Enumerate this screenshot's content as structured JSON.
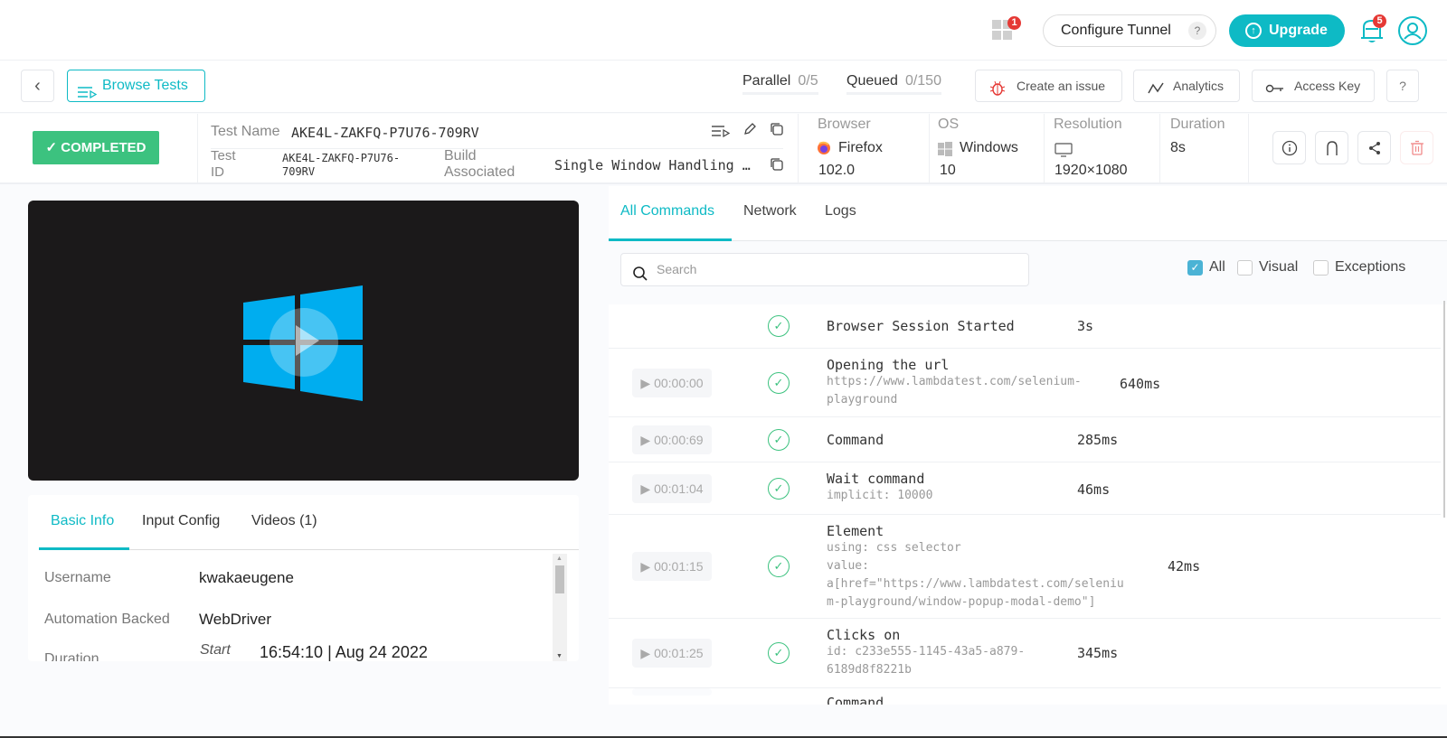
{
  "topbar": {
    "apps_badge": "1",
    "configure_tunnel": "Configure Tunnel",
    "tunnel_help": "?",
    "upgrade": "Upgrade",
    "notifications_badge": "5"
  },
  "toolbar": {
    "back": "‹",
    "browse_tests": "Browse Tests",
    "parallel_label": "Parallel",
    "parallel_value": "0/5",
    "queued_label": "Queued",
    "queued_value": "0/150",
    "create_issue": "Create an issue",
    "analytics": "Analytics",
    "access_key": "Access Key",
    "help": "?"
  },
  "test": {
    "status": "✓ COMPLETED",
    "name_label": "Test Name",
    "name": "AKE4L-ZAKFQ-P7U76-709RV",
    "id_label_1": "Test",
    "id_label_2": "ID",
    "id_line1": "AKE4L-ZAKFQ-P7U76-",
    "id_line2": "709RV",
    "build_label_1": "Build",
    "build_label_2": "Associated",
    "build": "Single Window Handling …",
    "browser_label": "Browser",
    "browser": "Firefox",
    "browser_version": "102.0",
    "os_label": "OS",
    "os": "Windows",
    "os_version": "10",
    "resolution_label": "Resolution",
    "resolution": "1920×1080",
    "duration_label": "Duration",
    "duration": "8s"
  },
  "info_tabs": [
    {
      "label": "Basic Info",
      "active": true
    },
    {
      "label": "Input Config",
      "active": false
    },
    {
      "label": "Videos (1)",
      "active": false
    }
  ],
  "basic_info": {
    "username_label": "Username",
    "username": "kwakaeugene",
    "automation_label": "Automation Backed",
    "automation": "WebDriver",
    "duration_label": "Duration",
    "start_label": "Start",
    "start_value": "16:54:10 | Aug 24 2022"
  },
  "command_tabs": [
    {
      "label": "All Commands",
      "active": true
    },
    {
      "label": "Network",
      "active": false
    },
    {
      "label": "Logs",
      "active": false
    }
  ],
  "filters": {
    "search_placeholder": "Search",
    "all": "All",
    "all_checked": true,
    "visual": "Visual",
    "visual_checked": false,
    "exceptions": "Exceptions",
    "exceptions_checked": false
  },
  "commands": [
    {
      "timestamp": "",
      "name": "Browser Session Started",
      "details": [],
      "duration": "3s"
    },
    {
      "timestamp": "▶ 00:00:00",
      "name": "Opening the url",
      "details": [
        "https://www.lambdatest.com/selenium-",
        "playground"
      ],
      "duration": "640ms"
    },
    {
      "timestamp": "▶ 00:00:69",
      "name": "Command",
      "details": [],
      "duration": "285ms"
    },
    {
      "timestamp": "▶ 00:01:04",
      "name": "Wait command",
      "details": [
        "implicit: 10000"
      ],
      "duration": "46ms"
    },
    {
      "timestamp": "▶ 00:01:15",
      "name": "Element",
      "details": [
        "using: css selector",
        "value:",
        "a[href=\"https://www.lambdatest.com/seleniu",
        "m-playground/window-popup-modal-demo\"]"
      ],
      "duration": "42ms"
    },
    {
      "timestamp": "▶ 00:01:25",
      "name": "Clicks on",
      "details": [
        "id: c233e555-1145-43a5-a879-",
        "6189d8f8221b"
      ],
      "duration": "345ms"
    },
    {
      "timestamp": "",
      "name": "Command",
      "details": [],
      "duration": ""
    }
  ],
  "colors": {
    "accent": "#0ebac5",
    "success": "#3cc27f",
    "danger": "#e53935",
    "windows_blue": "#00adef"
  }
}
